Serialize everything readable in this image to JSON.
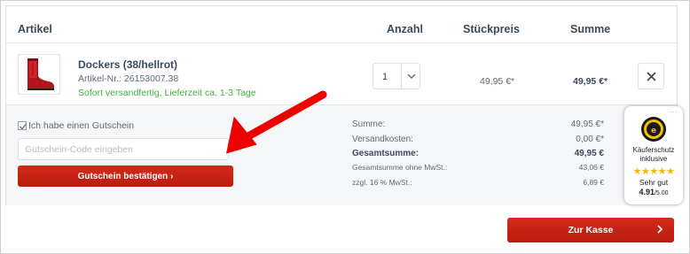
{
  "table_header": {
    "article": "Artikel",
    "quantity": "Anzahl",
    "unit_price": "Stückpreis",
    "total": "Summe"
  },
  "item": {
    "name": "Dockers (38/hellrot)",
    "article_number": "Artikel-Nr.: 26153007.38",
    "delivery": "Sofort versandfertig, Lieferzeit ca. 1-3 Tage",
    "quantity": "1",
    "unit_price": "49,95 €*",
    "line_total": "49,95 €*",
    "thumbnail_icon": "red-ankle-boot-image"
  },
  "voucher": {
    "checkbox_label": "Ich habe einen Gutschein",
    "checked": true,
    "placeholder": "Gutschein-Code eingeben",
    "button_label": "Gutschein bestätigen ›"
  },
  "summary": [
    {
      "label": "Summe:",
      "value": "49,95 €*"
    },
    {
      "label": "Versandkosten:",
      "value": "0,00 €*"
    },
    {
      "label": "Gesamtsumme:",
      "value": "49,95 €"
    },
    {
      "label": "Gesamtsumme ohne MwSt.:",
      "value": "43,06 €"
    },
    {
      "label": "zzgl. 16 % MwSt.:",
      "value": "6,89 €"
    }
  ],
  "checkout": {
    "label": "Zur Kasse"
  },
  "trusted_shops": {
    "badge_text": "Käuferschutz",
    "badge_text2": "inklusive",
    "stars": "★★★★★",
    "rating_label": "Sehr gut",
    "score": "4.91",
    "score_max": "/5.00",
    "menu": "···"
  },
  "colors": {
    "accent_red": "#c8220f",
    "delivery_green": "#3fb240",
    "text_dark": "#3b4a5c"
  }
}
